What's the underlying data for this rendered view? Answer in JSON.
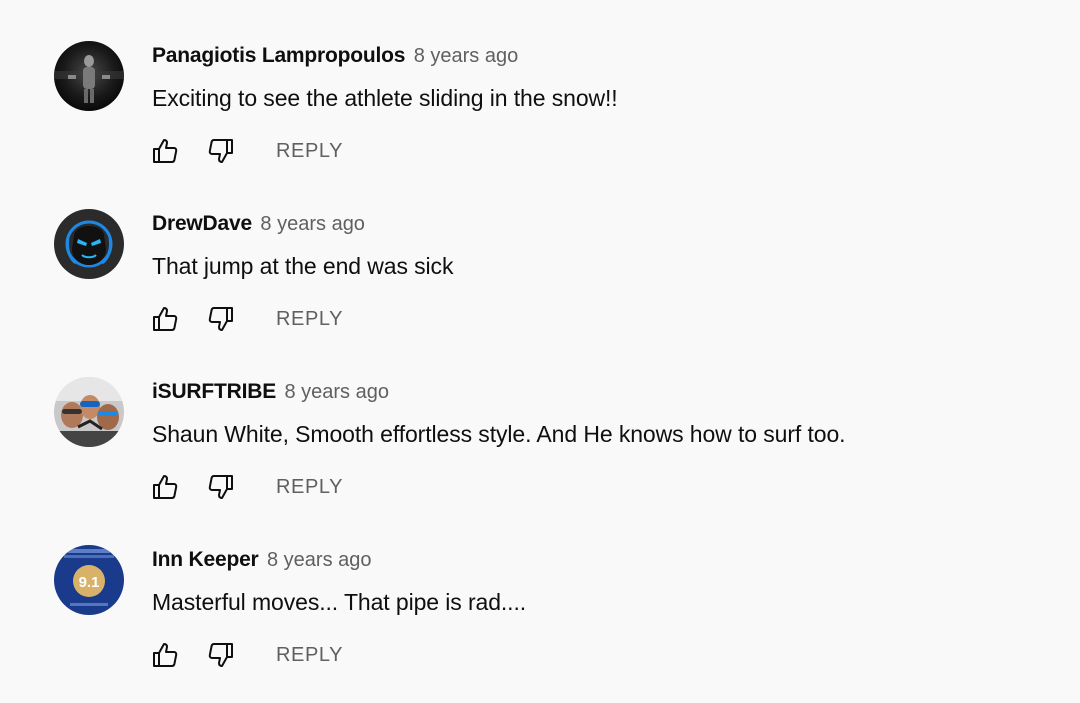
{
  "comments": [
    {
      "author": "Panagiotis Lampropoulos",
      "time": "8 years ago",
      "text": "Exciting to see the athlete sliding in the snow!!",
      "reply_label": "REPLY",
      "avatar": "dark-photo-avatar"
    },
    {
      "author": "DrewDave",
      "time": "8 years ago",
      "text": "That jump at the end was sick",
      "reply_label": "REPLY",
      "avatar": "gamer-logo-avatar"
    },
    {
      "author": "iSURFTRIBE",
      "time": "8 years ago",
      "text": "Shaun White, Smooth effortless style. And He knows how to surf too.",
      "reply_label": "REPLY",
      "avatar": "group-photo-avatar"
    },
    {
      "author": "Inn Keeper",
      "time": "8 years ago",
      "text": "Masterful moves... That pipe is rad....",
      "reply_label": "REPLY",
      "avatar": "badge-9-1-avatar",
      "avatar_badge": "9.1"
    }
  ],
  "colors": {
    "background": "#f9f9f9",
    "text": "#0f0f0f",
    "secondary": "#606060"
  },
  "icons": {
    "like": "thumbs-up-icon",
    "dislike": "thumbs-down-icon"
  }
}
